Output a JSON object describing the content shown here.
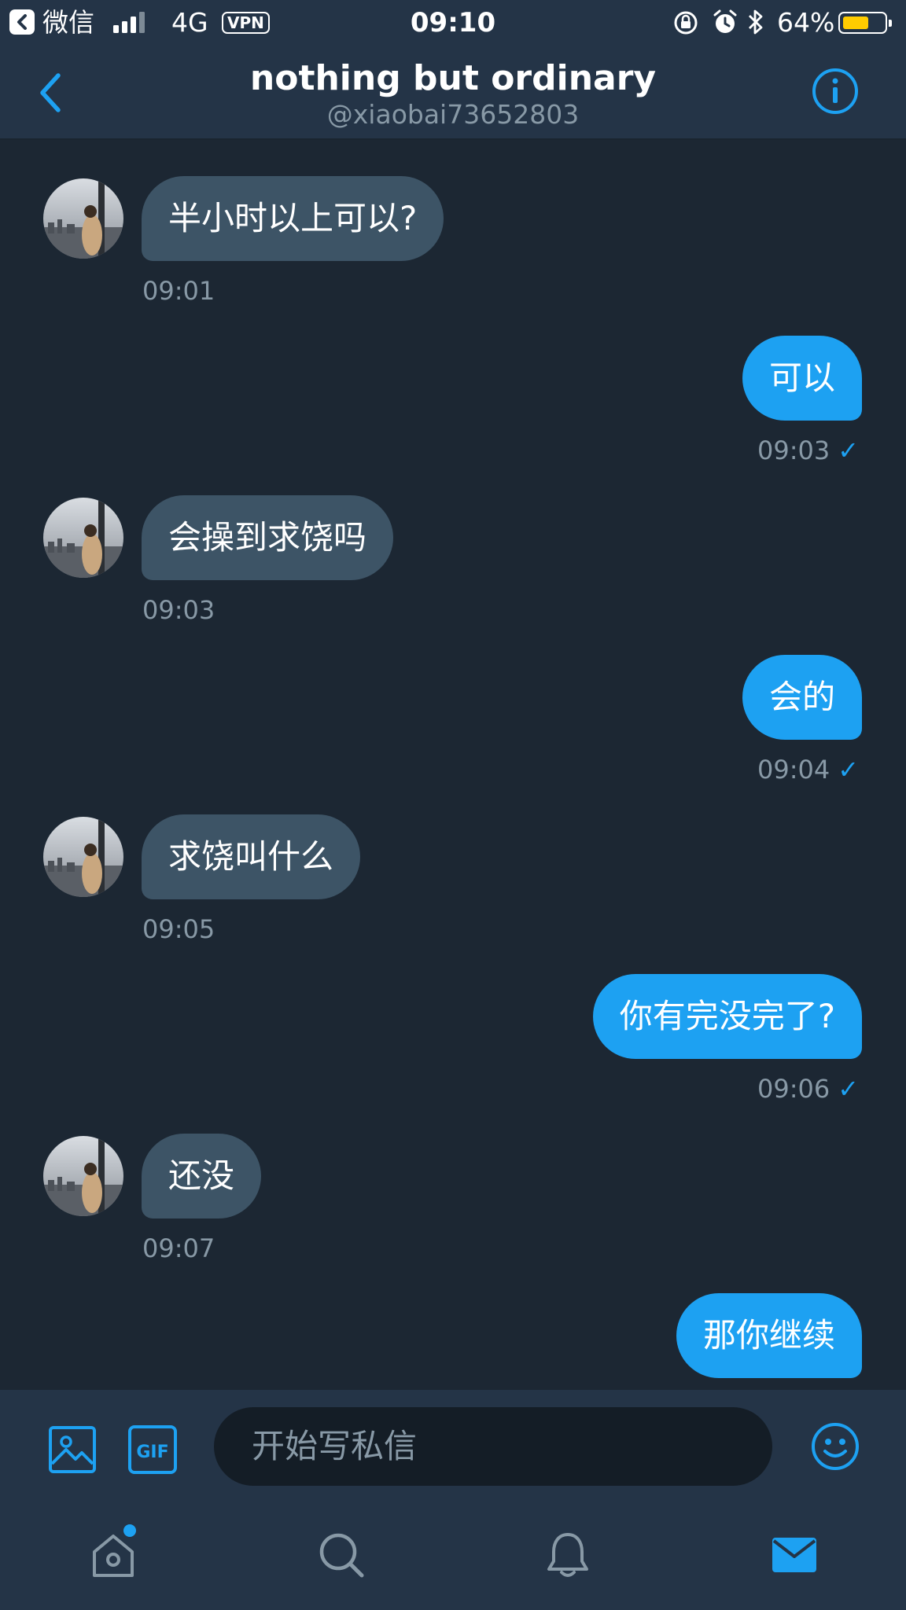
{
  "status_bar": {
    "back_app": "微信",
    "network": "4G",
    "vpn": "VPN",
    "time": "09:10",
    "battery_text": "64%",
    "battery_level": 0.64
  },
  "header": {
    "title": "nothing but ordinary",
    "handle": "@xiaobai73652803"
  },
  "messages": [
    {
      "dir": "in",
      "text": "半小时以上可以?",
      "time": "09:01"
    },
    {
      "dir": "out",
      "text": "可以",
      "time": "09:03"
    },
    {
      "dir": "in",
      "text": "会操到求饶吗",
      "time": "09:03"
    },
    {
      "dir": "out",
      "text": "会的",
      "time": "09:04"
    },
    {
      "dir": "in",
      "text": "求饶叫什么",
      "time": "09:05"
    },
    {
      "dir": "out",
      "text": "你有完没完了?",
      "time": "09:06"
    },
    {
      "dir": "in",
      "text": "还没",
      "time": "09:07"
    },
    {
      "dir": "out",
      "text": "那你继续",
      "time": ""
    }
  ],
  "composer": {
    "placeholder": "开始写私信",
    "gif_label": "GIF"
  },
  "colors": {
    "background": "#1c2733",
    "bar": "#243447",
    "incoming_bubble": "#3d5466",
    "outgoing_bubble": "#1da1f2",
    "accent": "#1da1f2",
    "muted_text": "#8899a6"
  },
  "icons": {
    "back": "chevron-left-icon",
    "info": "info-icon",
    "image": "image-icon",
    "gif": "gif-icon",
    "emoji": "emoji-icon",
    "home": "home-icon",
    "search": "search-icon",
    "notifications": "bell-icon",
    "messages": "mail-icon"
  }
}
